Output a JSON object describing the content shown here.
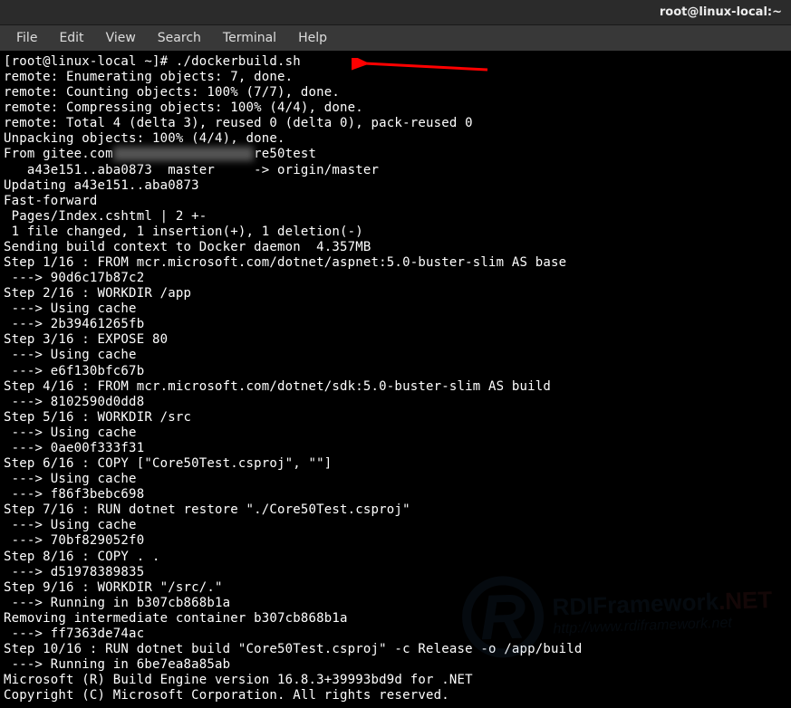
{
  "window": {
    "title": "root@linux-local:~"
  },
  "menu": {
    "file": "File",
    "edit": "Edit",
    "view": "View",
    "search": "Search",
    "terminal": "Terminal",
    "help": "Help"
  },
  "terminal": {
    "lines": [
      "[root@linux-local ~]# ./dockerbuild.sh",
      "remote: Enumerating objects: 7, done.",
      "remote: Counting objects: 100% (7/7), done.",
      "remote: Compressing objects: 100% (4/4), done.",
      "remote: Total 4 (delta 3), reused 0 (delta 0), pack-reused 0",
      "Unpacking objects: 100% (4/4), done.",
      "From gitee.com|BLUR|re50test",
      "   a43e151..aba0873  master     -> origin/master",
      "Updating a43e151..aba0873",
      "Fast-forward",
      " Pages/Index.cshtml | 2 +-",
      " 1 file changed, 1 insertion(+), 1 deletion(-)",
      "Sending build context to Docker daemon  4.357MB",
      "Step 1/16 : FROM mcr.microsoft.com/dotnet/aspnet:5.0-buster-slim AS base",
      " ---> 90d6c17b87c2",
      "Step 2/16 : WORKDIR /app",
      " ---> Using cache",
      " ---> 2b39461265fb",
      "Step 3/16 : EXPOSE 80",
      " ---> Using cache",
      " ---> e6f130bfc67b",
      "Step 4/16 : FROM mcr.microsoft.com/dotnet/sdk:5.0-buster-slim AS build",
      " ---> 8102590d0dd8",
      "Step 5/16 : WORKDIR /src",
      " ---> Using cache",
      " ---> 0ae00f333f31",
      "Step 6/16 : COPY [\"Core50Test.csproj\", \"\"]",
      " ---> Using cache",
      " ---> f86f3bebc698",
      "Step 7/16 : RUN dotnet restore \"./Core50Test.csproj\"",
      " ---> Using cache",
      " ---> 70bf829052f0",
      "Step 8/16 : COPY . .",
      " ---> d51978389835",
      "Step 9/16 : WORKDIR \"/src/.\"",
      " ---> Running in b307cb868b1a",
      "Removing intermediate container b307cb868b1a",
      " ---> ff7363de74ac",
      "Step 10/16 : RUN dotnet build \"Core50Test.csproj\" -c Release -o /app/build",
      " ---> Running in 6be7ea8a85ab",
      "Microsoft (R) Build Engine version 16.8.3+39993bd9d for .NET",
      "Copyright (C) Microsoft Corporation. All rights reserved."
    ]
  },
  "watermark": {
    "letter": "R",
    "title_prefix": "RDIFramework",
    "title_suffix": ".NET",
    "url": "http://www.rdiframework.net"
  }
}
